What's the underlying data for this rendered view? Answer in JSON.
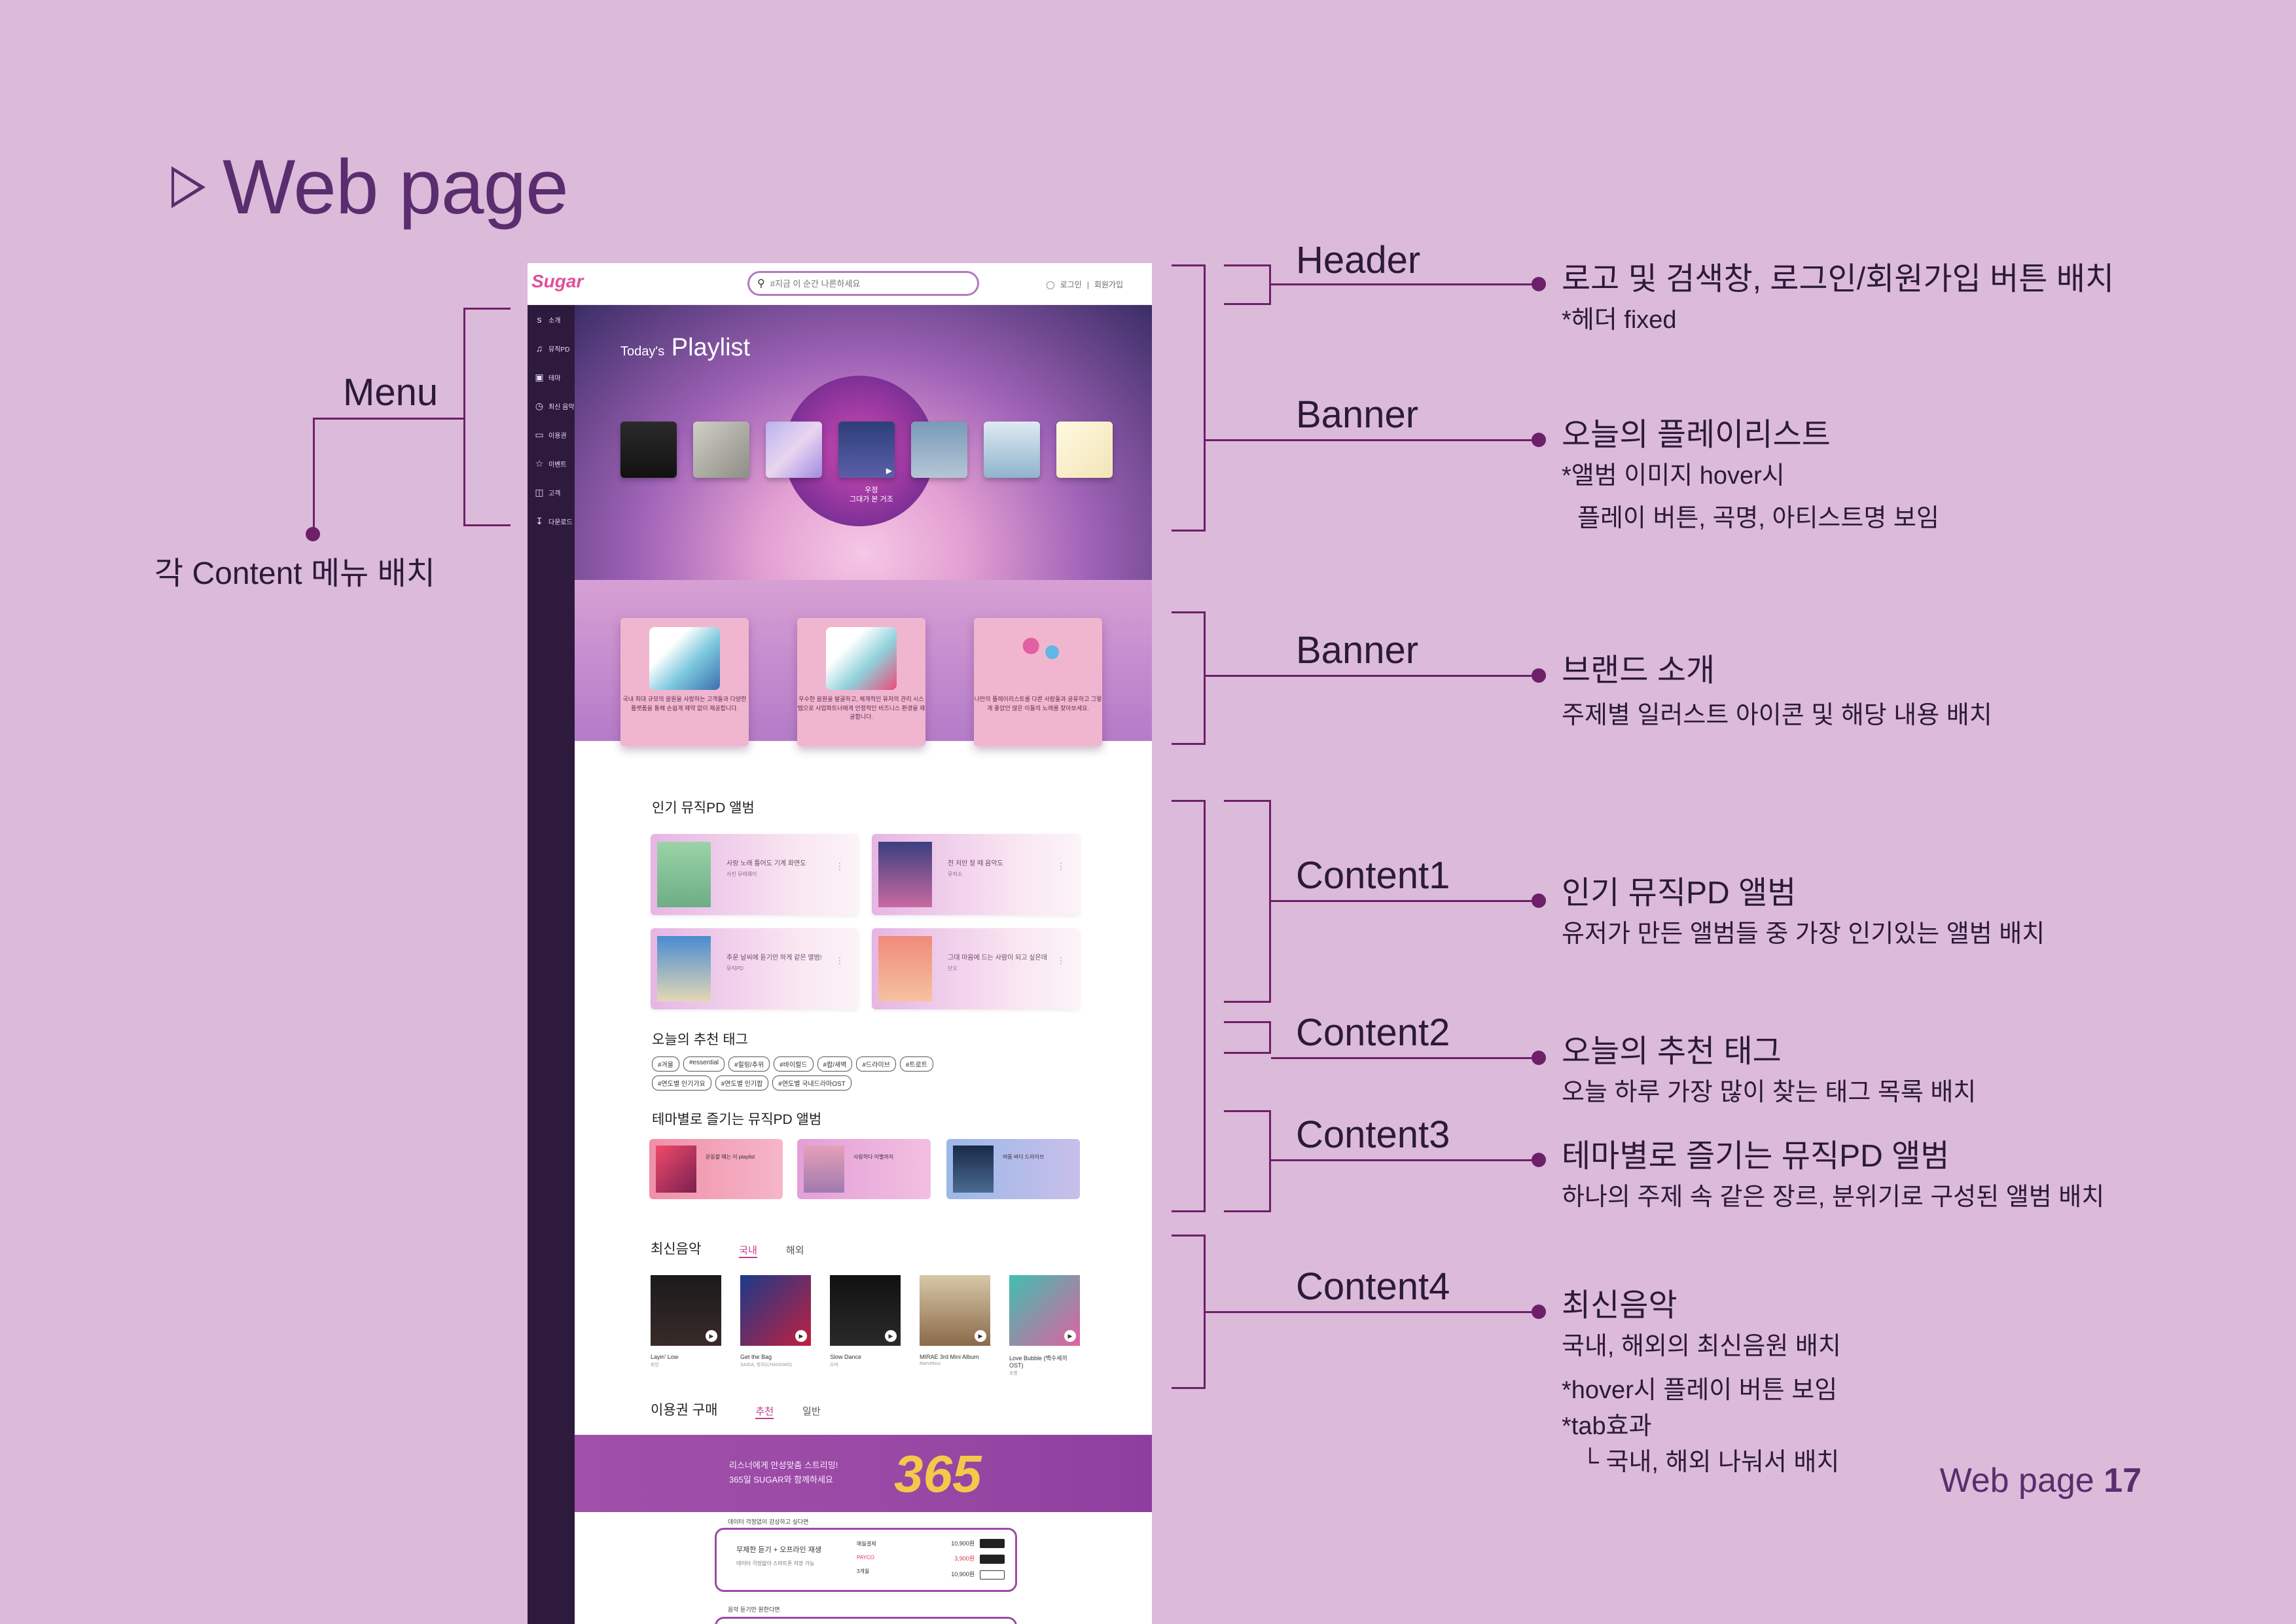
{
  "slide": {
    "title": "Web page",
    "page_label": "Web page",
    "page_number": "17"
  },
  "annotations": {
    "menu": {
      "label": "Menu",
      "desc": "각 Content 메뉴 배치"
    },
    "header": {
      "label": "Header",
      "head": "로고 및 검색창, 로그인/회원가입 버튼 배치",
      "sub": "*헤더 fixed"
    },
    "banner1": {
      "label": "Banner",
      "head": "오늘의 플레이리스트",
      "sub1": "*앨범 이미지 hover시",
      "sub2": "플레이 버튼, 곡명, 아티스트명 보임"
    },
    "banner2": {
      "label": "Banner",
      "head": "브랜드 소개",
      "sub": "주제별 일러스트 아이콘 및 해당 내용 배치"
    },
    "content1": {
      "label": "Content1",
      "head": "인기 뮤직PD 앨범",
      "sub": "유저가 만든 앨범들 중 가장 인기있는 앨범 배치"
    },
    "content2": {
      "label": "Content2",
      "head": "오늘의 추천 태그",
      "sub": "오늘 하루 가장 많이 찾는 태그 목록 배치"
    },
    "content3": {
      "label": "Content3",
      "head": "테마별로 즐기는 뮤직PD 앨범",
      "sub": "하나의 주제 속 같은 장르, 분위기로 구성된 앨범 배치"
    },
    "content4": {
      "label": "Content4",
      "head": "최신음악",
      "sub1": "국내, 해외의 최신음원 배치",
      "sub2": "*hover시 플레이 버튼 보임",
      "sub3": "*tab효과",
      "sub4": "└ 국내, 해외 나눠서 배치"
    }
  },
  "site": {
    "logo": "Sugar",
    "search_placeholder": "#지금 이 순간 나른하세요",
    "login": "로그인",
    "signup": "회원가입",
    "sidebar": [
      "소개",
      "뮤직PD",
      "테마",
      "최신 음악",
      "이용권",
      "이벤트",
      "고객",
      "다운로드"
    ],
    "banner": {
      "today": "Today's",
      "playlist": "Playlist",
      "caption_title": "우정",
      "caption_artist": "그대가 본 거조"
    },
    "brand_cards": [
      {
        "text": "국내 최대 규모의 음원을 사랑하는 고객들과 다양한 플랫폼을 통해 손쉽게 제약 없이 제공합니다."
      },
      {
        "text": "우수한 음원을 발굴하고, 체계적인 유저의 관리 시스템으로 사업파트너에게 안정적인 비즈니스 환경을 제공합니다."
      },
      {
        "text": "나만의 플레이리스트를 다른 사람들과 공유하고 그렇게 좋았던 많은 이들의 노래를 찾아보세요."
      }
    ],
    "pd_title": "인기 뮤직PD 앨범",
    "pd_albums": [
      {
        "title": "사랑 노래 틀어도 기계 화면도",
        "sub": "사진 뮤레웨이"
      },
      {
        "title": "전 저만 잘 때 음악도",
        "sub": "뮤직소"
      },
      {
        "title": "추운 날씨에 듣기만 하게 같은 앨범!",
        "sub": "뮤직PD"
      },
      {
        "title": "그대 마음에 드는 사람이 되고 싶은데",
        "sub": "단오"
      }
    ],
    "tags_title": "오늘의 추천 태그",
    "tags": [
      "#겨울",
      "#essential",
      "#힐링/추위",
      "#바이럴드",
      "#팝/새벽",
      "#드라이브",
      "#트로트",
      "#연도별 인기가요",
      "#연도별 인기팝",
      "#연도별 국내드라마OST"
    ],
    "theme_title": "테마별로 즐기는 뮤직PD 앨범",
    "theme_albums": [
      {
        "title": "운동할 때는 이 playlist"
      },
      {
        "title": "사랑하다 이별까지"
      },
      {
        "title": "여름 바다 드라이브"
      }
    ],
    "new_music": {
      "title": "최신음악",
      "tab_domestic": "국내",
      "tab_foreign": "해외",
      "items": [
        {
          "title": "Layin' Low",
          "artist": "휘인"
        },
        {
          "title": "Get the Bag",
          "artist": "SAIDA, 창모(CHANGMO)"
        },
        {
          "title": "Slow Dance",
          "artist": "오마"
        },
        {
          "title": "MIRAE 3rd Mini Album",
          "artist": "Marvelous"
        },
        {
          "title": "Love Bubble (백수세끼 OST)",
          "artist": "초롱"
        }
      ]
    },
    "ticket": {
      "title": "이용권 구매",
      "tab_recommend": "추천",
      "tab_general": "일반",
      "promo_line1": "리스너에게 안성맞춤 스트리밍!",
      "promo_line2": "365일 SUGAR와 함께하세요",
      "promo_number": "365",
      "plan_label": "데이터 걱정없이 감상하고 싶다면",
      "plan_title": "무제한 듣기 + 오프라인 재생",
      "plan_sub": "데이터 걱정없이 스마트폰 저장 가능",
      "plan_options": [
        "매월결제",
        "PAYCO",
        "3개월"
      ],
      "plan_prices": [
        "10,900원",
        "3,900원",
        "10,900원"
      ],
      "bottom_label": "음악 듣기만 원한다면"
    }
  }
}
